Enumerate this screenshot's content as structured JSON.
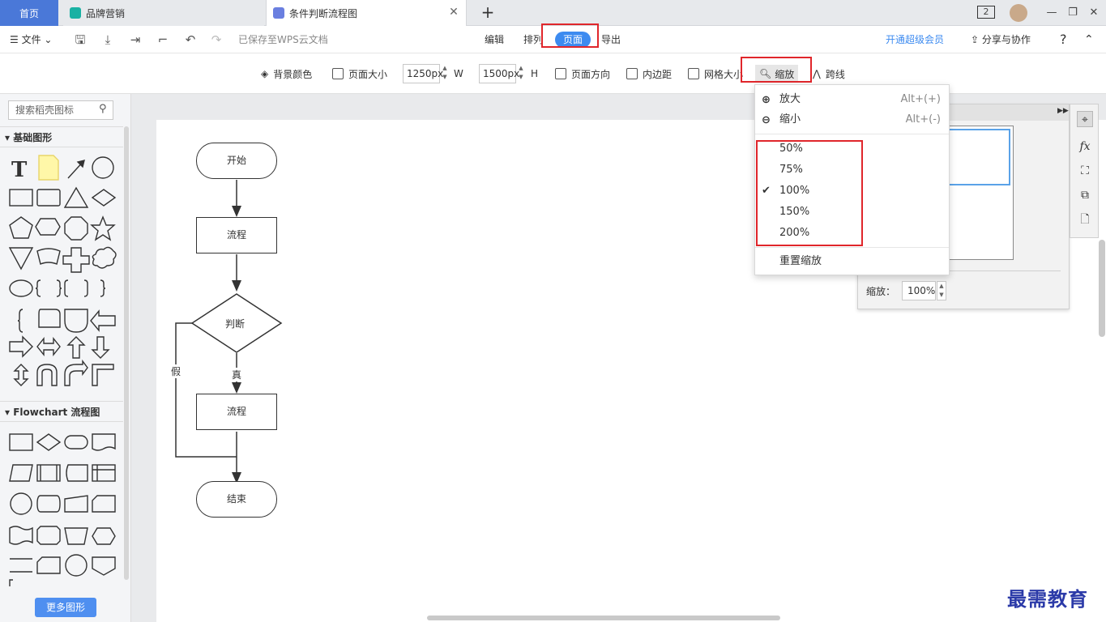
{
  "tabs": {
    "home": "首页",
    "tab1": "品牌营销",
    "tab2": "条件判断流程图",
    "add": "+",
    "close": "✕",
    "window_count": "2"
  },
  "menubar": {
    "file": "文件",
    "saved_status": "已保存至WPS云文档",
    "tabs": [
      "编辑",
      "排列",
      "页面",
      "导出"
    ],
    "vip": "开通超级会员",
    "share": "分享与协作",
    "help": "?"
  },
  "toolbar": {
    "bg_color": "背景颜色",
    "page_size": "页面大小",
    "width_value": "1250px",
    "width_unit": "W",
    "height_value": "1500px",
    "height_unit": "H",
    "orientation": "页面方向",
    "padding": "内边距",
    "grid_size": "网格大小",
    "zoom": "缩放",
    "cross_line": "跨线"
  },
  "left_panel": {
    "search_placeholder": "搜索稻壳图标",
    "section1": "基础图形",
    "section2": "Flowchart 流程图",
    "more_shapes": "更多图形"
  },
  "flowchart": {
    "start": "开始",
    "process1": "流程",
    "decision": "判断",
    "true_label": "真",
    "false_label": "假",
    "process2": "流程",
    "end": "结束"
  },
  "zoom_menu": {
    "zoom_in": "放大",
    "zoom_in_shortcut": "Alt+(+)",
    "zoom_out": "缩小",
    "zoom_out_shortcut": "Alt+(-)",
    "levels": [
      "50%",
      "75%",
      "100%",
      "150%",
      "200%"
    ],
    "selected": "100%",
    "reset": "重置缩放"
  },
  "zoom_panel": {
    "label": "缩放：",
    "value": "100%"
  },
  "watermark": "最需教育",
  "colors": {
    "accent": "#3d8bf0",
    "highlight": "#e0262b",
    "home_tab": "#4a78d8"
  }
}
